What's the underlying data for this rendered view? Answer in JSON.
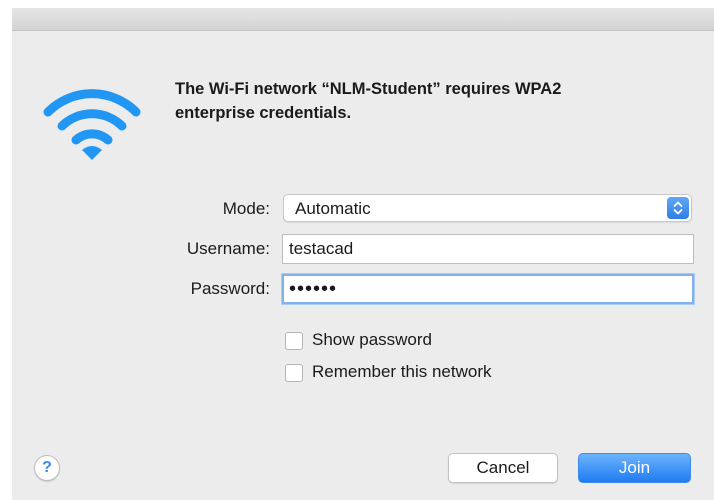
{
  "message": {
    "line1": "The Wi-Fi network “NLM-Student” requires WPA2",
    "line2": "enterprise credentials."
  },
  "icons": {
    "network": "wifi-icon",
    "help": "help-icon",
    "stepper": "chevron-up-down-icon"
  },
  "form": {
    "mode_label": "Mode:",
    "mode_value": "Automatic",
    "username_label": "Username:",
    "username_value": "testacad",
    "password_label": "Password:",
    "password_masked": "••••••"
  },
  "options": {
    "show_password": "Show password",
    "remember_network": "Remember this network"
  },
  "help": {
    "glyph": "?"
  },
  "buttons": {
    "cancel": "Cancel",
    "join": "Join"
  },
  "colors": {
    "accent": "#2f7de6",
    "wifi": "#2196f3",
    "background": "#ececec"
  }
}
